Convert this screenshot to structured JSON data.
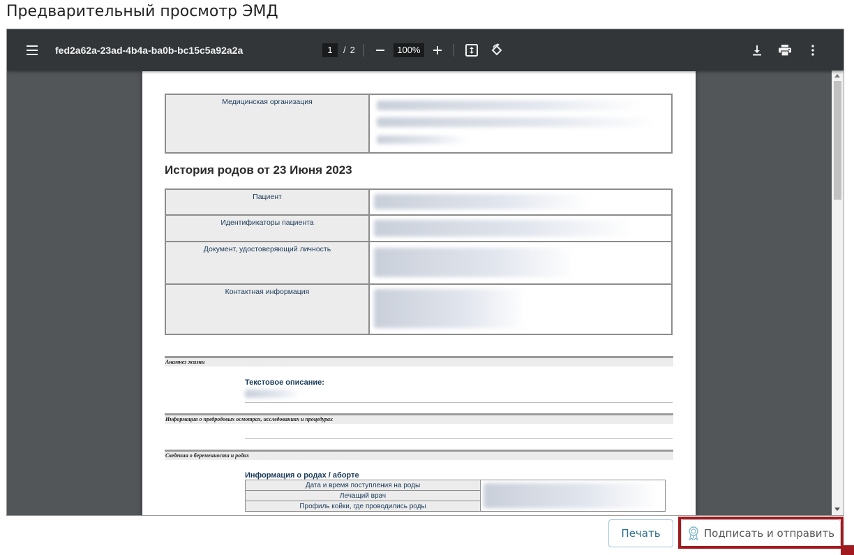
{
  "dialog": {
    "title": "Предварительный просмотр ЭМД"
  },
  "viewer": {
    "file_name": "fed2a62a-23ad-4b4a-ba0b-bc15c5a92a2a",
    "page_current": "1",
    "page_separator": "/",
    "page_total": "2",
    "zoom": "100%"
  },
  "document": {
    "org_label": "Медицинская организация",
    "heading": "История родов от 23 Июня 2023",
    "patient_rows": [
      "Пациент",
      "Идентификаторы пациента",
      "Документ, удостоверяющий личность",
      "Контактная информация"
    ],
    "sections": {
      "anamnesis": "Анамнез жизни",
      "text_description": "Текстовое описание:",
      "prenatal": "Информация о предродовых осмотрах, исследованиях и процедурах",
      "pregnancy": "Сведения о беременности и родах",
      "birth_info": "Информация о родах / аборте"
    },
    "birth_rows": [
      "Дата и время поступления на роды",
      "Лечащий врач",
      "Профиль койки, где проводились роды"
    ]
  },
  "buttons": {
    "print": "Печать",
    "sign_send": "Подписать и отправить"
  },
  "colors": {
    "toolbar_bg": "#323639",
    "viewer_bg": "#525659",
    "highlight": "#a01a1f",
    "print_button_text": "#2e6f8e"
  }
}
